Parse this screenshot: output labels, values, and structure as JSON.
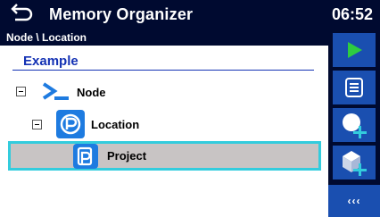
{
  "header": {
    "title": "Memory Organizer",
    "clock": "06:52",
    "back_icon": "back-arrow-icon"
  },
  "breadcrumb": "Node \\ Location",
  "structure": {
    "title": "Example"
  },
  "tree": {
    "node": {
      "label": "Node",
      "icon": "node-icon"
    },
    "location": {
      "label": "Location",
      "icon": "location-icon"
    },
    "project": {
      "label": "Project",
      "icon": "project-icon",
      "selected": true
    }
  },
  "sidebar": {
    "buttons": [
      {
        "name": "start-test-button",
        "icon": "play-icon"
      },
      {
        "name": "view-results-button",
        "icon": "list-icon"
      },
      {
        "name": "add-node-button",
        "icon": "add-circle-icon"
      },
      {
        "name": "add-structure-button",
        "icon": "add-structure-icon"
      }
    ],
    "more_label": "‹‹‹"
  },
  "colors": {
    "title_bar": "#000a30",
    "sidebar_button": "#1a4fb0",
    "accent_blue": "#1432b4",
    "selection_border": "#33ccdd",
    "selection_fill": "#c8c4c4",
    "play_green": "#2ecc40"
  }
}
